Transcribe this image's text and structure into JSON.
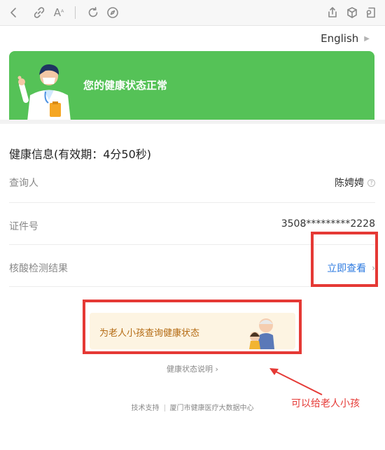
{
  "toolbar": {
    "icons": [
      "back-icon",
      "link-icon",
      "font-size-icon",
      "refresh-icon",
      "compass-icon",
      "share-icon",
      "cube-icon",
      "profile-icon"
    ],
    "font_size_label": "A"
  },
  "language": {
    "label": "English"
  },
  "banner": {
    "title": "您的健康状态正常",
    "color": "#55c257"
  },
  "health_info": {
    "title": "健康信息(有效期：4分50秒)",
    "rows": [
      {
        "label": "查询人",
        "value": "陈娉娉"
      },
      {
        "label": "证件号",
        "value": "3508*********2228"
      },
      {
        "label": "核酸检测结果",
        "value": "立即查看"
      }
    ]
  },
  "elder_card": {
    "label": "为老人小孩查询健康状态"
  },
  "explain_link": {
    "label": "健康状态说明 ›"
  },
  "footer": {
    "left": "技术支持",
    "right": "厦门市健康医疗大数据中心"
  },
  "annotation": {
    "text": "可以给老人小孩",
    "color": "#e53935"
  }
}
